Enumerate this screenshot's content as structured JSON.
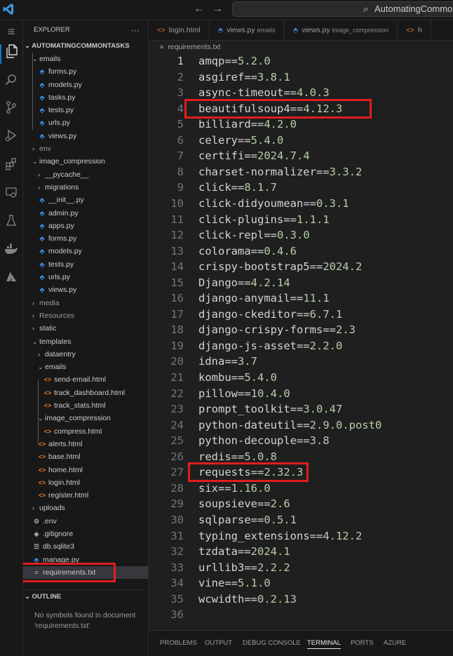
{
  "title_bar": {
    "search_text": "AutomatingCommon"
  },
  "activity_bar": {
    "items": [
      "menu",
      "explorer",
      "search",
      "source-control",
      "run-debug",
      "extensions",
      "remote-explorer",
      "testing",
      "docker",
      "azure"
    ]
  },
  "explorer": {
    "header": "EXPLORER",
    "more": "···",
    "root": "AUTOMATINGCOMMONTASKS",
    "tree": [
      {
        "label": "emails",
        "type": "folder-open",
        "depth": 1
      },
      {
        "label": "forms.py",
        "type": "py",
        "depth": 2
      },
      {
        "label": "models.py",
        "type": "py",
        "depth": 2
      },
      {
        "label": "tasks.py",
        "type": "py",
        "depth": 2
      },
      {
        "label": "tests.py",
        "type": "py",
        "depth": 2
      },
      {
        "label": "urls.py",
        "type": "py",
        "depth": 2
      },
      {
        "label": "views.py",
        "type": "py",
        "depth": 2
      },
      {
        "label": "env",
        "type": "folder",
        "depth": 1
      },
      {
        "label": "image_compression",
        "type": "folder-open",
        "depth": 1
      },
      {
        "label": "__pycache__",
        "type": "folder",
        "depth": 2
      },
      {
        "label": "migrations",
        "type": "folder",
        "depth": 2
      },
      {
        "label": "__init__.py",
        "type": "py",
        "depth": 2
      },
      {
        "label": "admin.py",
        "type": "py",
        "depth": 2
      },
      {
        "label": "apps.py",
        "type": "py",
        "depth": 2
      },
      {
        "label": "forms.py",
        "type": "py",
        "depth": 2
      },
      {
        "label": "models.py",
        "type": "py",
        "depth": 2
      },
      {
        "label": "tests.py",
        "type": "py",
        "depth": 2
      },
      {
        "label": "urls.py",
        "type": "py",
        "depth": 2
      },
      {
        "label": "views.py",
        "type": "py",
        "depth": 2
      },
      {
        "label": "media",
        "type": "folder",
        "depth": 1
      },
      {
        "label": "Resources",
        "type": "folder",
        "depth": 1
      },
      {
        "label": "static",
        "type": "folder",
        "depth": 1
      },
      {
        "label": "templates",
        "type": "folder-open",
        "depth": 1
      },
      {
        "label": "dataentry",
        "type": "folder",
        "depth": 2
      },
      {
        "label": "emails",
        "type": "folder-open",
        "depth": 2
      },
      {
        "label": "send-email.html",
        "type": "html",
        "depth": 3
      },
      {
        "label": "track_dashboard.html",
        "type": "html",
        "depth": 3
      },
      {
        "label": "track_stats.html",
        "type": "html",
        "depth": 3
      },
      {
        "label": "image_compression",
        "type": "folder-open",
        "depth": 2
      },
      {
        "label": "compress.html",
        "type": "html",
        "depth": 3
      },
      {
        "label": "alerts.html",
        "type": "html",
        "depth": 2
      },
      {
        "label": "base.html",
        "type": "html",
        "depth": 2
      },
      {
        "label": "home.html",
        "type": "html",
        "depth": 2
      },
      {
        "label": "login.html",
        "type": "html",
        "depth": 2
      },
      {
        "label": "register.html",
        "type": "html",
        "depth": 2
      },
      {
        "label": "uploads",
        "type": "folder",
        "depth": 1
      },
      {
        "label": ".env",
        "type": "env",
        "depth": 1
      },
      {
        "label": ".gitignore",
        "type": "git",
        "depth": 1
      },
      {
        "label": "db.sqlite3",
        "type": "db",
        "depth": 1
      },
      {
        "label": "manage.py",
        "type": "py",
        "depth": 1
      },
      {
        "label": "requirements.txt",
        "type": "txt",
        "depth": 1,
        "selected": true
      }
    ],
    "outline_header": "OUTLINE",
    "outline_message": "No symbols found in document 'requirements.txt'"
  },
  "tabs": [
    {
      "label": "login.html",
      "hint": "",
      "icon": "html"
    },
    {
      "label": "views.py",
      "hint": "emails",
      "icon": "py"
    },
    {
      "label": "views.py",
      "hint": "image_compression",
      "icon": "py"
    },
    {
      "label": "h",
      "hint": "",
      "icon": "html"
    }
  ],
  "breadcrumb": "requirements.txt",
  "editor": {
    "current_line": 1,
    "lines": [
      [
        "amqp",
        "==",
        "5.2.0"
      ],
      [
        "asgiref",
        "==",
        "3.8.1"
      ],
      [
        "async-timeout",
        "==",
        "4.0.3"
      ],
      [
        "beautifulsoup4",
        "==",
        "4.12.3"
      ],
      [
        "billiard",
        "==",
        "4.2.0"
      ],
      [
        "celery",
        "==",
        "5.4.0"
      ],
      [
        "certifi",
        "==",
        "2024.7.4"
      ],
      [
        "charset-normalizer",
        "==",
        "3.3.2"
      ],
      [
        "click",
        "==",
        "8.1.7"
      ],
      [
        "click-didyoumean",
        "==",
        "0.3.1"
      ],
      [
        "click-plugins",
        "==",
        "1.1.1"
      ],
      [
        "click-repl",
        "==",
        "0.3.0"
      ],
      [
        "colorama",
        "==",
        "0.4.6"
      ],
      [
        "crispy-bootstrap5",
        "==",
        "2024.2"
      ],
      [
        "Django",
        "==",
        "4.2.14"
      ],
      [
        "django-anymail",
        "==",
        "11.1"
      ],
      [
        "django-ckeditor",
        "==",
        "6.7.1"
      ],
      [
        "django-crispy-forms",
        "==",
        "2.3"
      ],
      [
        "django-js-asset",
        "==",
        "2.2.0"
      ],
      [
        "idna",
        "==",
        "3.7"
      ],
      [
        "kombu",
        "==",
        "5.4.0"
      ],
      [
        "pillow",
        "==",
        "10.4.0"
      ],
      [
        "prompt_toolkit",
        "==",
        "3.0.47"
      ],
      [
        "python-dateutil",
        "==",
        "2.9.0.post0"
      ],
      [
        "python-decouple",
        "==",
        "3.8"
      ],
      [
        "redis",
        "==",
        "5.0.8"
      ],
      [
        "requests",
        "==",
        "2.32.3"
      ],
      [
        "six",
        "==",
        "1.16.0"
      ],
      [
        "soupsieve",
        "==",
        "2.6"
      ],
      [
        "sqlparse",
        "==",
        "0.5.1"
      ],
      [
        "typing_extensions",
        "==",
        "4.12.2"
      ],
      [
        "tzdata",
        "==",
        "2024.1"
      ],
      [
        "urllib3",
        "==",
        "2.2.2"
      ],
      [
        "vine",
        "==",
        "5.1.0"
      ],
      [
        "wcwidth",
        "==",
        "0.2.13"
      ],
      [
        "",
        "",
        ""
      ]
    ],
    "highlighted_lines": [
      4,
      27
    ]
  },
  "panel_tabs": [
    "PROBLEMS",
    "OUTPUT",
    "DEBUG CONSOLE",
    "TERMINAL",
    "PORTS",
    "AZURE"
  ],
  "panel_active": "TERMINAL",
  "colors": {
    "highlight_box": "#e11d1d",
    "accent": "#0078d4",
    "package": "#d4d4d4",
    "version": "#b5cea8"
  }
}
